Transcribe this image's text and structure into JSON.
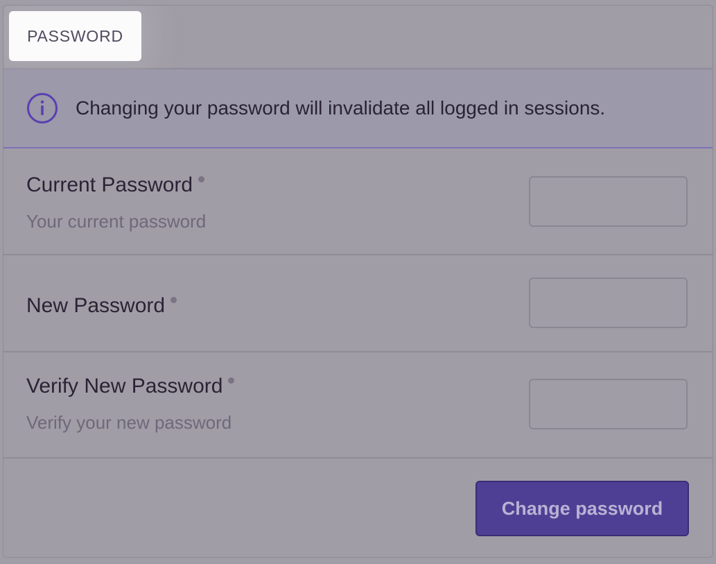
{
  "panel": {
    "header": {
      "title": "PASSWORD"
    },
    "alert": {
      "icon": "info-circle-icon",
      "message": "Changing your password will invalidate all logged in sessions."
    },
    "fields": [
      {
        "label": "Current Password",
        "help": "Your current password",
        "value": "",
        "required": true
      },
      {
        "label": "New Password",
        "help": "",
        "value": "",
        "required": true
      },
      {
        "label": "Verify New Password",
        "help": "Verify your new password",
        "value": "",
        "required": true
      }
    ],
    "submit_label": "Change password"
  },
  "colors": {
    "accent": "#4f3f94",
    "info_icon": "#5b3fb0",
    "background": "#a19da6"
  }
}
